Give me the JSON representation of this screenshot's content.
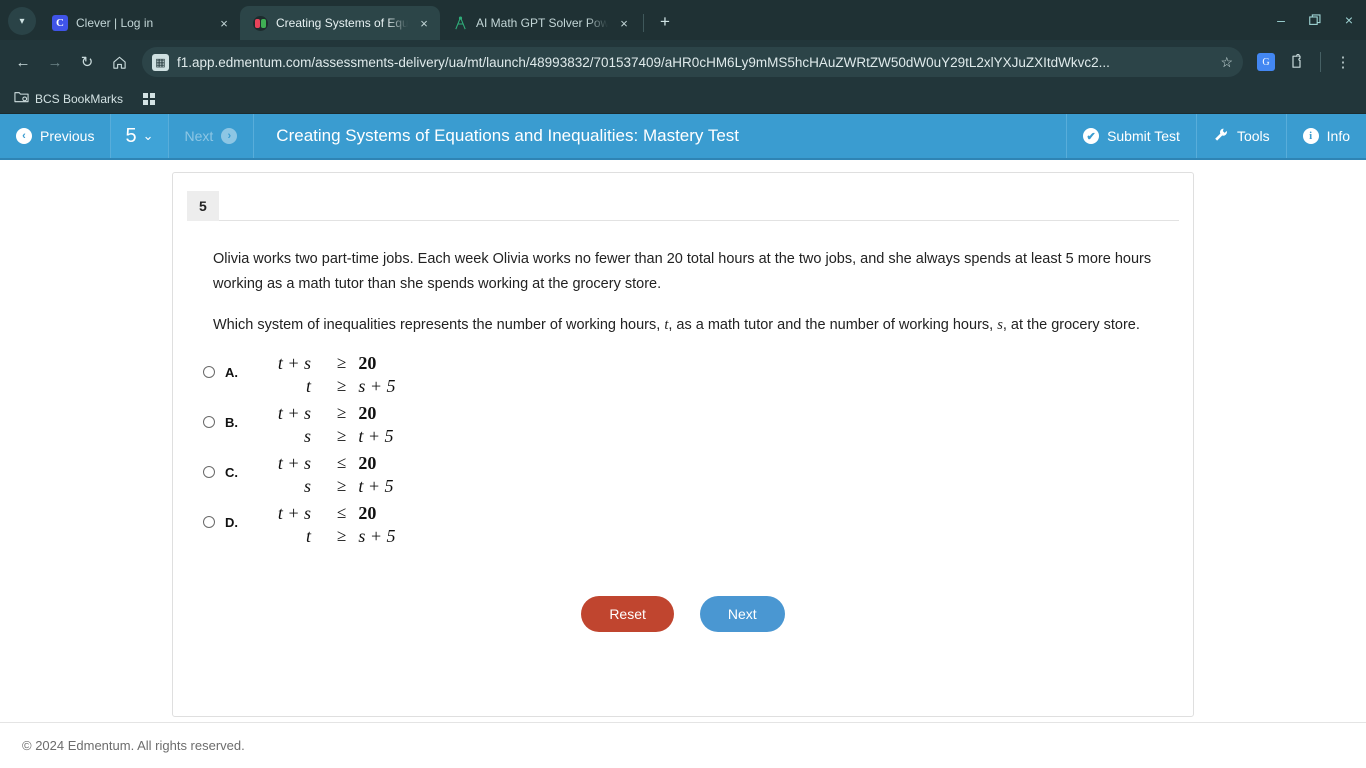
{
  "browser": {
    "tabs": [
      {
        "title": "Clever | Log in",
        "favicon": "clever-icon",
        "active": false
      },
      {
        "title": "Creating Systems of Equations",
        "favicon": "edmentum-icon",
        "active": true
      },
      {
        "title": "AI Math GPT Solver Powered by",
        "favicon": "compass-icon",
        "active": false
      }
    ],
    "new_tab_label": "+",
    "close_label": "×",
    "window_controls": {
      "minimize": "–",
      "maximize": "❐",
      "close": "×"
    },
    "nav": {
      "back": "←",
      "forward": "→",
      "reload": "↻",
      "home": "⌂"
    },
    "omnibox": {
      "url": "f1.app.edmentum.com/assessments-delivery/ua/mt/launch/48993832/701537409/aHR0cHM6Ly9mMS5hcHAuZWRtZW50dW0uY29tL2xlYXJuZXItdWkvc2...",
      "site_icon": "page-info-icon",
      "star": "☆"
    },
    "toolbar_icons": {
      "translate": "G",
      "extensions": "puzzle-icon",
      "menu": "⋮"
    },
    "bookmarks": {
      "folder_label": "BCS BookMarks",
      "apps_icon": "apps-grid-icon"
    }
  },
  "apptop": {
    "previous_label": "Previous",
    "question_number": "5",
    "chevron": "⌄",
    "next_label": "Next",
    "title": "Creating Systems of Equations and Inequalities: Mastery Test",
    "submit_label": "Submit Test",
    "tools_label": "Tools",
    "info_label": "Info",
    "submit_icon": "✔",
    "tools_icon": "🔧",
    "info_icon": "i",
    "prev_icon": "‹",
    "next_icon": "›"
  },
  "question": {
    "number": "5",
    "paragraph1_a": "Olivia works two part-time jobs. Each week Olivia works no fewer than 20 total hours at the two jobs, and she always spends at least 5 more hours working as a math tutor than she spends working at the grocery store.",
    "paragraph2_a": "Which system of inequalities represents the number of working hours, ",
    "paragraph2_var1": "t",
    "paragraph2_b": ", as a math tutor and the number of working hours, ",
    "paragraph2_var2": "s",
    "paragraph2_c": ", at the grocery store.",
    "paragraph2_end": "?"
  },
  "options": [
    {
      "letter": "A.",
      "selected": false,
      "line1": {
        "lhs": "t + s",
        "op": "≥",
        "rhs": "20"
      },
      "line2": {
        "lhs": "t",
        "op": "≥",
        "rhs": "s + 5"
      }
    },
    {
      "letter": "B.",
      "selected": false,
      "line1": {
        "lhs": "t + s",
        "op": "≥",
        "rhs": "20"
      },
      "line2": {
        "lhs": "s",
        "op": "≥",
        "rhs": "t + 5"
      }
    },
    {
      "letter": "C.",
      "selected": false,
      "line1": {
        "lhs": "t + s",
        "op": "≤",
        "rhs": "20"
      },
      "line2": {
        "lhs": "s",
        "op": "≥",
        "rhs": "t + 5"
      }
    },
    {
      "letter": "D.",
      "selected": false,
      "line1": {
        "lhs": "t + s",
        "op": "≤",
        "rhs": "20"
      },
      "line2": {
        "lhs": "t",
        "op": "≥",
        "rhs": "s + 5"
      }
    }
  ],
  "actions": {
    "reset_label": "Reset",
    "next_label": "Next"
  },
  "footer": {
    "copyright": "© 2024 Edmentum. All rights reserved."
  },
  "colors": {
    "app_blue": "#3a9cd0",
    "reset_red": "#c0452f",
    "next_blue": "#4a97d2",
    "chrome_dark": "#22363a"
  }
}
